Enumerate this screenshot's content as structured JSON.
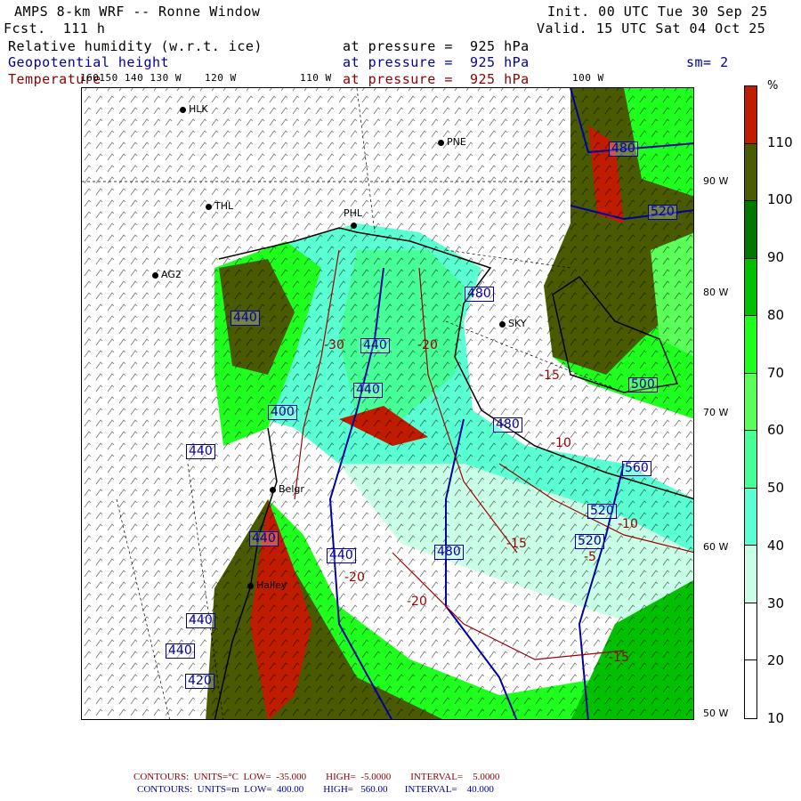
{
  "header": {
    "title": "AMPS 8-km WRF -- Ronne Window",
    "forecast": "Fcst.  111 h",
    "init": "Init. 00 UTC Tue 30 Sep 25",
    "valid": "Valid. 15 UTC Sat 04 Oct 25",
    "fields": [
      {
        "name": "Relative humidity (w.r.t. ice)",
        "level": "at pressure =  925 hPa"
      },
      {
        "name": "Geopotential height",
        "level": "at pressure =  925 hPa"
      },
      {
        "name": "Temperature",
        "level": "at pressure =  925 hPa"
      }
    ],
    "smoothing": "sm= 2"
  },
  "map": {
    "longitude_labels": [
      "160150 140 130 W",
      "120 W",
      "110 W",
      "100 W"
    ],
    "latitude_labels": [
      "90 W",
      "80 W",
      "70 W",
      "60 W",
      "50 W"
    ],
    "stations": [
      {
        "id": "HLK"
      },
      {
        "id": "PNE"
      },
      {
        "id": "THL"
      },
      {
        "id": "PHL"
      },
      {
        "id": "AG2"
      },
      {
        "id": "SKY"
      },
      {
        "id": "Belgr"
      },
      {
        "id": "Halley"
      }
    ],
    "height_contour_labels": [
      "480",
      "520",
      "440",
      "440",
      "440",
      "480",
      "500",
      "480",
      "560",
      "520",
      "520",
      "440",
      "440",
      "480",
      "440",
      "440",
      "440",
      "420",
      "400"
    ],
    "temperature_contour_labels": [
      "-30",
      "-20",
      "-15",
      "-10",
      "-15",
      "-5",
      "-20",
      "-20",
      "-15",
      "-10"
    ]
  },
  "colorbar": {
    "unit": "%",
    "labels": [
      "110",
      "100",
      "90",
      "80",
      "70",
      "60",
      "50",
      "40",
      "30",
      "20",
      "10"
    ],
    "colors": [
      "#c01c00",
      "#4a5a00",
      "#007800",
      "#00c000",
      "#1eff1e",
      "#5aff5a",
      "#46ff96",
      "#5affd2",
      "#c8ffe6",
      "#ffffff",
      "#ffffff",
      "#ffffff"
    ]
  },
  "footer": {
    "temperature": "CONTOURS:  UNITS=°C  LOW=  -35.000        HIGH=  -5.0000        INTERVAL=    5.0000",
    "height": "CONTOURS:  UNITS=m  LOW=  400.00        HIGH=   560.00       INTERVAL=    40.000"
  }
}
